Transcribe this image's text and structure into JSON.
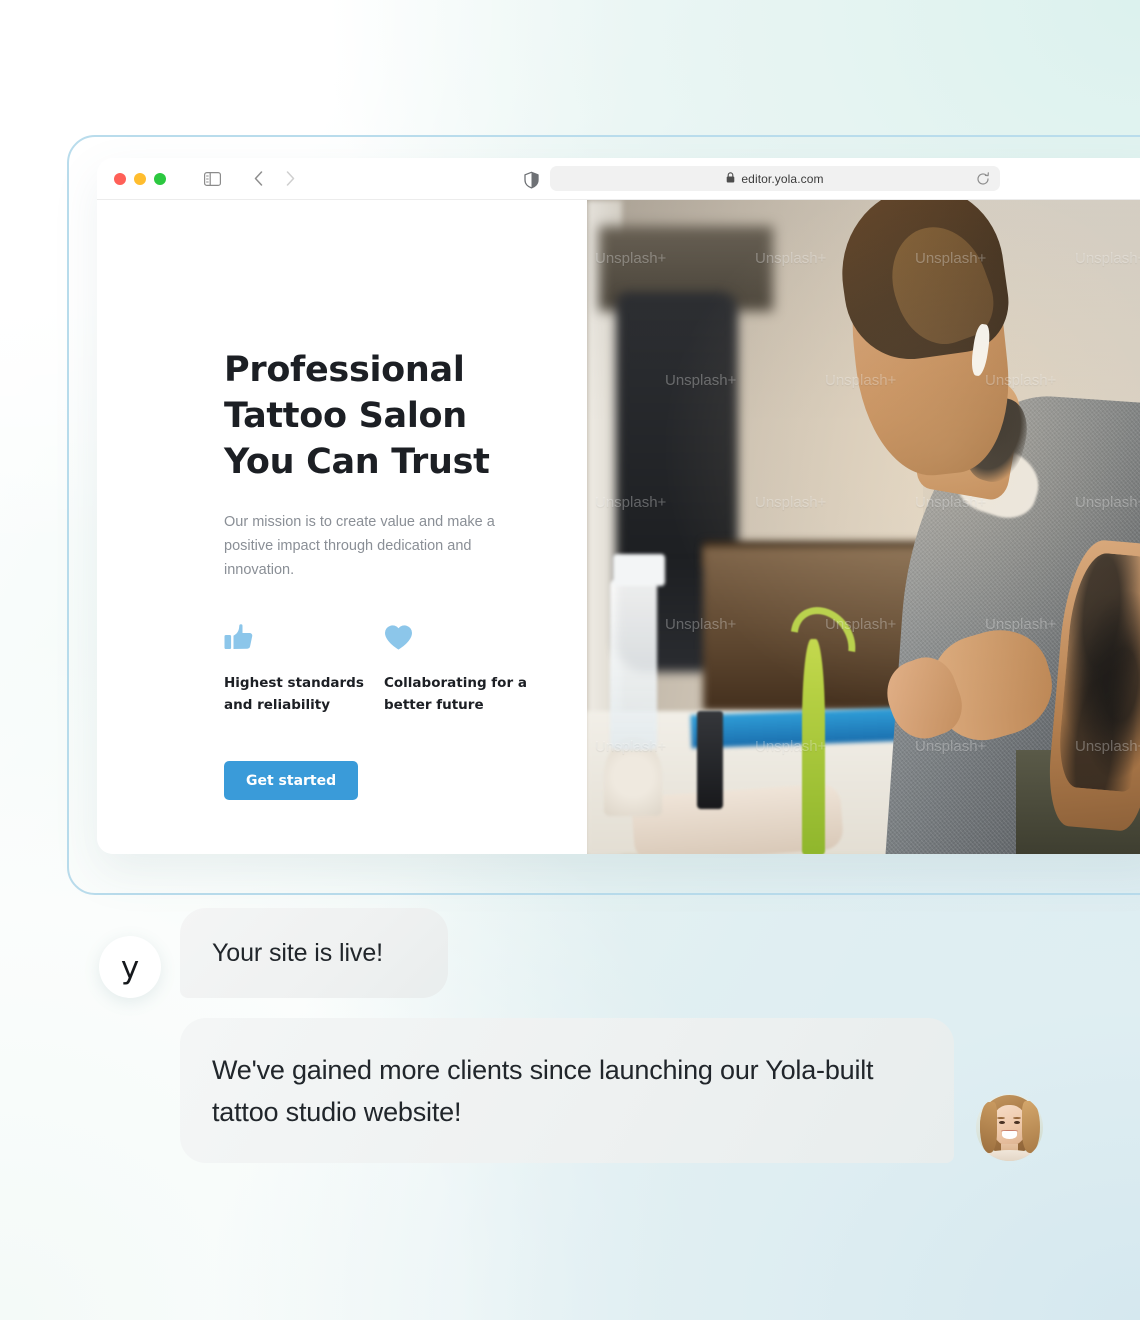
{
  "browser": {
    "traffic_lights": [
      "close",
      "minimize",
      "maximize"
    ],
    "sidebar_icon": "sidebar-toggle-icon",
    "back_icon": "chevron-left-icon",
    "forward_icon": "chevron-right-icon",
    "shield_icon": "shield-privacy-icon",
    "lock_icon": "lock-icon",
    "reload_icon": "reload-icon",
    "url": "editor.yola.com"
  },
  "site": {
    "headline": "Professional Tattoo Salon You Can Trust",
    "subhead": "Our mission is to create value and make a positive impact through dedication and innovation.",
    "features": [
      {
        "icon": "thumbs-up-icon",
        "label": "Highest standards and reliability"
      },
      {
        "icon": "heart-icon",
        "label": "Collaborating for a better future"
      }
    ],
    "cta_label": "Get started",
    "hero_image_alt": "Tattoo artist preparing equipment in studio",
    "hero_watermark": "Unsplash+",
    "colors": {
      "cta_background": "#3a9bd9",
      "feature_icon": "#8cc6ea",
      "headline": "#1c1f24",
      "subhead": "#8a8f96"
    }
  },
  "chat": {
    "brand_avatar_letter": "y",
    "messages": [
      {
        "text": "Your site is live!",
        "side": "left"
      },
      {
        "text": "We've gained more clients since launching our Yola-built tattoo studio website!",
        "side": "right"
      }
    ],
    "user_avatar_alt": "Smiling woman portrait"
  },
  "theme": {
    "shell_border": "#b9dcec",
    "bubble_background": "#f1f3f3",
    "page_gradient_from": "#ffffff",
    "page_gradient_to": "#d8e9f0"
  }
}
